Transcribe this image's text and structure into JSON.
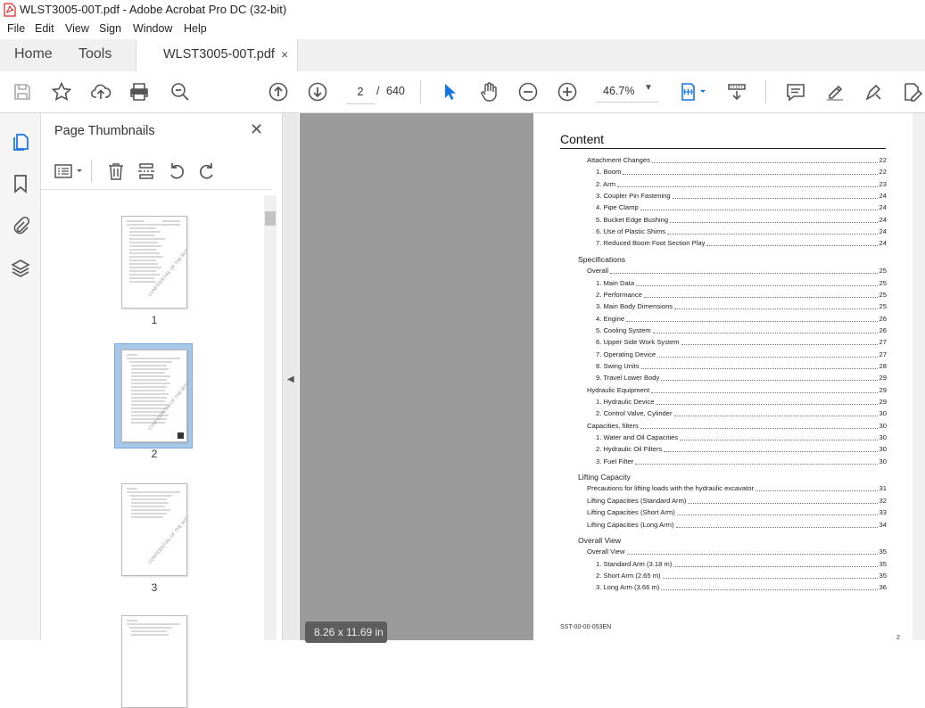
{
  "window": {
    "title": "WLST3005-00T.pdf - Adobe Acrobat Pro DC (32-bit)"
  },
  "menu": [
    "File",
    "Edit",
    "View",
    "Sign",
    "Window",
    "Help"
  ],
  "tabs": {
    "home": "Home",
    "tools": "Tools",
    "document": "WLST3005-00T.pdf",
    "close": "×"
  },
  "toolbar": {
    "current_page": "2",
    "page_separator": "/",
    "total_pages": "640",
    "zoom": "46.7%"
  },
  "panel": {
    "title": "Page Thumbnails",
    "thumbnails": [
      {
        "label": "1",
        "selected": false
      },
      {
        "label": "2",
        "selected": true
      },
      {
        "label": "3",
        "selected": false
      }
    ]
  },
  "viewer": {
    "page_size": "8.26 x 11.69 in"
  },
  "document": {
    "title": "Content",
    "footer": "SST-00-00-053EN",
    "page_number": "2",
    "sections": [
      {
        "entries": [
          {
            "label": "Attachment Changes",
            "page": "22",
            "level": 1
          },
          {
            "label": "1.   Boom",
            "page": "22",
            "level": 2
          },
          {
            "label": "2.   Arm",
            "page": "23",
            "level": 2
          },
          {
            "label": "3.   Coupler Pin Fastening",
            "page": "24",
            "level": 2
          },
          {
            "label": "4.   Pipe Clamp",
            "page": "24",
            "level": 2
          },
          {
            "label": "5.   Bucket Edge Bushing",
            "page": "24",
            "level": 2
          },
          {
            "label": "6.   Use of Plastic Shims",
            "page": "24",
            "level": 2
          },
          {
            "label": "7.   Reduced Boom Foot Section Play",
            "page": "24",
            "level": 2
          }
        ]
      },
      {
        "heading": "Specifications",
        "entries": [
          {
            "label": "Overall",
            "page": "25",
            "level": 1
          },
          {
            "label": "1.   Main Data",
            "page": "25",
            "level": 2
          },
          {
            "label": "2.   Performance",
            "page": "25",
            "level": 2
          },
          {
            "label": "3.   Main Body Dimensions",
            "page": "25",
            "level": 2
          },
          {
            "label": "4.   Engine",
            "page": "26",
            "level": 2
          },
          {
            "label": "5.   Cooling System",
            "page": "26",
            "level": 2
          },
          {
            "label": "6.   Upper Side Work System",
            "page": "27",
            "level": 2
          },
          {
            "label": "7.   Operating Device",
            "page": "27",
            "level": 2
          },
          {
            "label": "8.   Swing Units",
            "page": "28",
            "level": 2
          },
          {
            "label": "9.   Travel Lower Body",
            "page": "29",
            "level": 2
          },
          {
            "label": "Hydraulic Equipment",
            "page": "29",
            "level": 1
          },
          {
            "label": "1.   Hydraulic Device",
            "page": "29",
            "level": 2
          },
          {
            "label": "2.   Control Valve, Cylinder",
            "page": "30",
            "level": 2
          },
          {
            "label": "Capacities, filters",
            "page": "30",
            "level": 1
          },
          {
            "label": "1.   Water and Oil Capacities",
            "page": "30",
            "level": 2
          },
          {
            "label": "2.   Hydraulic Oil Filters",
            "page": "30",
            "level": 2
          },
          {
            "label": "3.   Fuel Filter",
            "page": "30",
            "level": 2
          }
        ]
      },
      {
        "heading": "Lifting Capacity",
        "entries": [
          {
            "label": "Precautions for lifting loads with the hydraulic excavator",
            "page": "31",
            "level": 1
          },
          {
            "label": "Lifting Capacities (Standard Arm)",
            "page": "32",
            "level": 1
          },
          {
            "label": "Lifting Capacities (Short Arm)",
            "page": "33",
            "level": 1
          },
          {
            "label": "Lifting Capacities (Long Arm)",
            "page": "34",
            "level": 1
          }
        ]
      },
      {
        "heading": "Overall View",
        "entries": [
          {
            "label": "Overall View",
            "page": "35",
            "level": 1
          },
          {
            "label": "1.   Standard Arm (3.18 m)",
            "page": "35",
            "level": 2
          },
          {
            "label": "2.   Short Arm (2.65 m)",
            "page": "35",
            "level": 2
          },
          {
            "label": "3.   Long Arm (3.66 m)",
            "page": "36",
            "level": 2
          }
        ]
      }
    ]
  },
  "colors": {
    "acrobat_red": "#d9261c",
    "accent_blue": "#1473e6",
    "viewer_gray": "#9b9b9b",
    "selection_blue": "#a9c7e6"
  }
}
